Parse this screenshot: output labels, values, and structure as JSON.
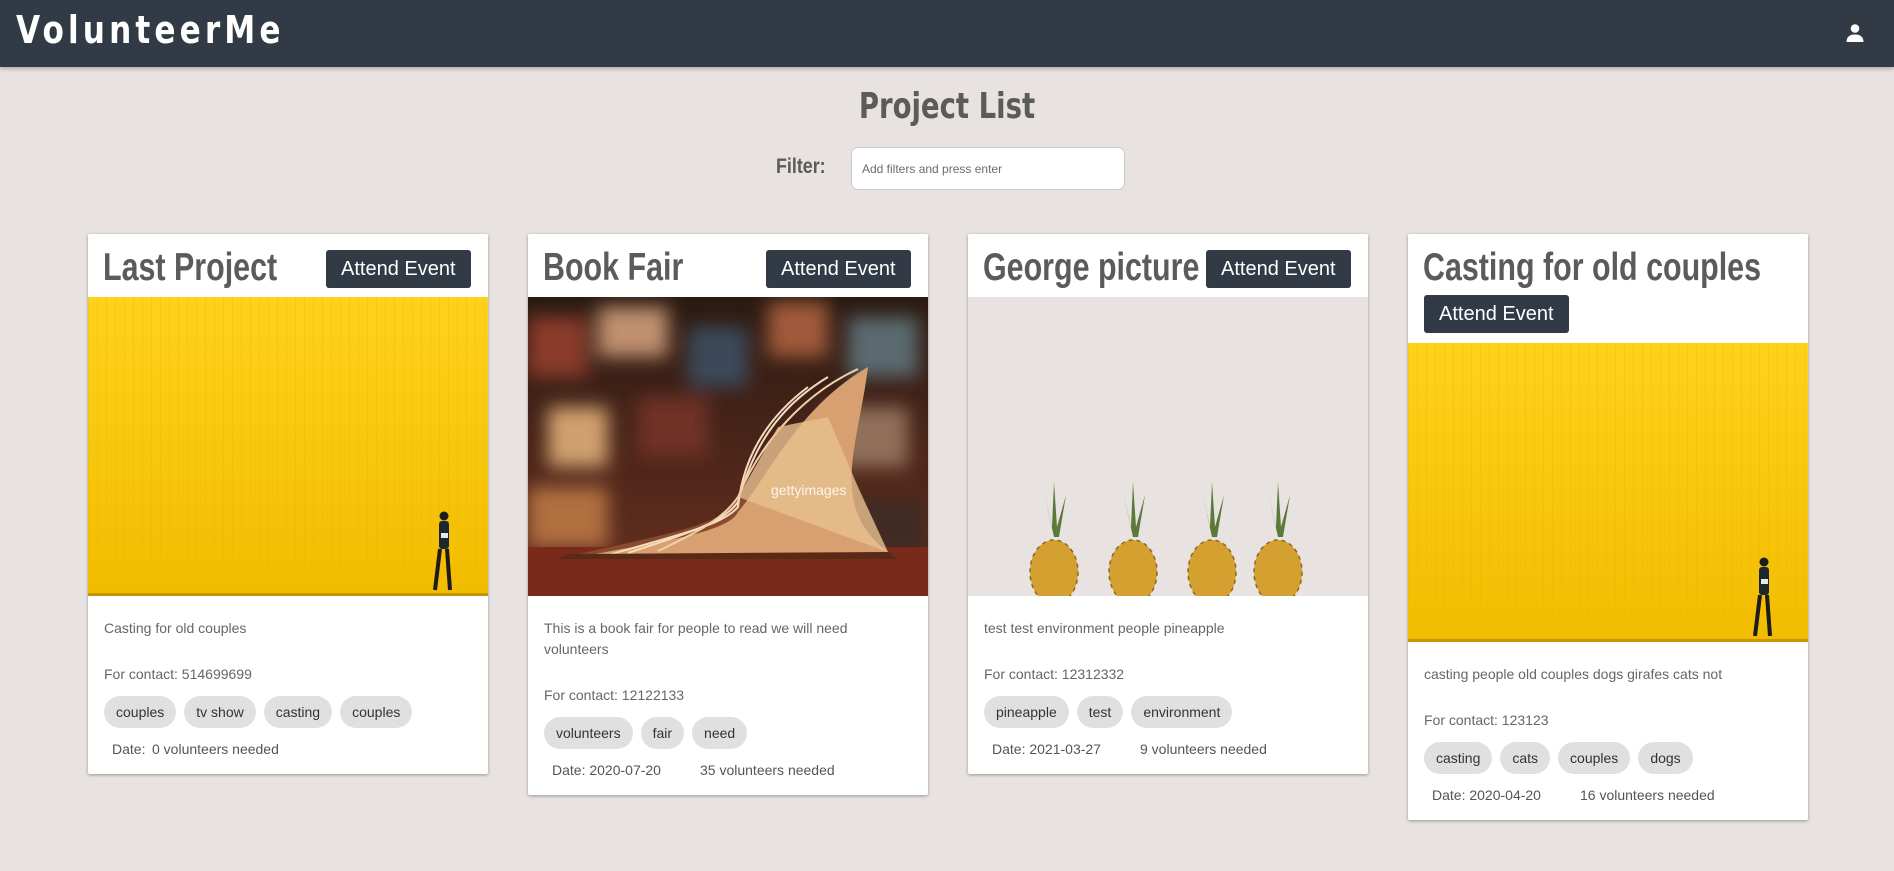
{
  "header": {
    "brand": "VolunteerMe",
    "user_icon": "user-icon"
  },
  "main": {
    "title": "Project List",
    "filter": {
      "label": "Filter:",
      "placeholder": "Add filters and press enter",
      "value": ""
    }
  },
  "projects": [
    {
      "title": "Last Project",
      "button": "Attend Event",
      "image": "yellow-wall-walker",
      "description": "Casting for old couples",
      "contact": "For contact: 514699699",
      "tags": [
        "couples",
        "tv show",
        "casting",
        "couples"
      ],
      "date": "Date:",
      "volunteers": "0 volunteers needed"
    },
    {
      "title": "Book Fair",
      "button": "Attend Event",
      "image": "open-book-library",
      "image_watermark": "gettyimages",
      "description": "This is a book fair for people to read we will need volunteers",
      "contact": "For contact: 12122133",
      "tags": [
        "volunteers",
        "fair",
        "need"
      ],
      "date": "Date: 2020-07-20",
      "volunteers": "35 volunteers needed"
    },
    {
      "title": "George picture",
      "button": "Attend Event",
      "image": "pineapples",
      "description": "test test environment people pineapple",
      "contact": "For contact: 12312332",
      "tags": [
        "pineapple",
        "test",
        "environment"
      ],
      "date": "Date: 2021-03-27",
      "volunteers": "9 volunteers needed"
    },
    {
      "title": "Casting for old couples",
      "button": "Attend Event",
      "image": "yellow-wall-walker",
      "description": "casting people old couples dogs girafes cats not",
      "contact": "For contact: 123123",
      "tags": [
        "casting",
        "cats",
        "couples",
        "dogs"
      ],
      "date": "Date: 2020-04-20",
      "volunteers": "16 volunteers needed"
    }
  ],
  "colors": {
    "navbar": "#323a45",
    "background": "#e8e3e1",
    "button": "#323a45",
    "chip": "#e0e0e0"
  }
}
